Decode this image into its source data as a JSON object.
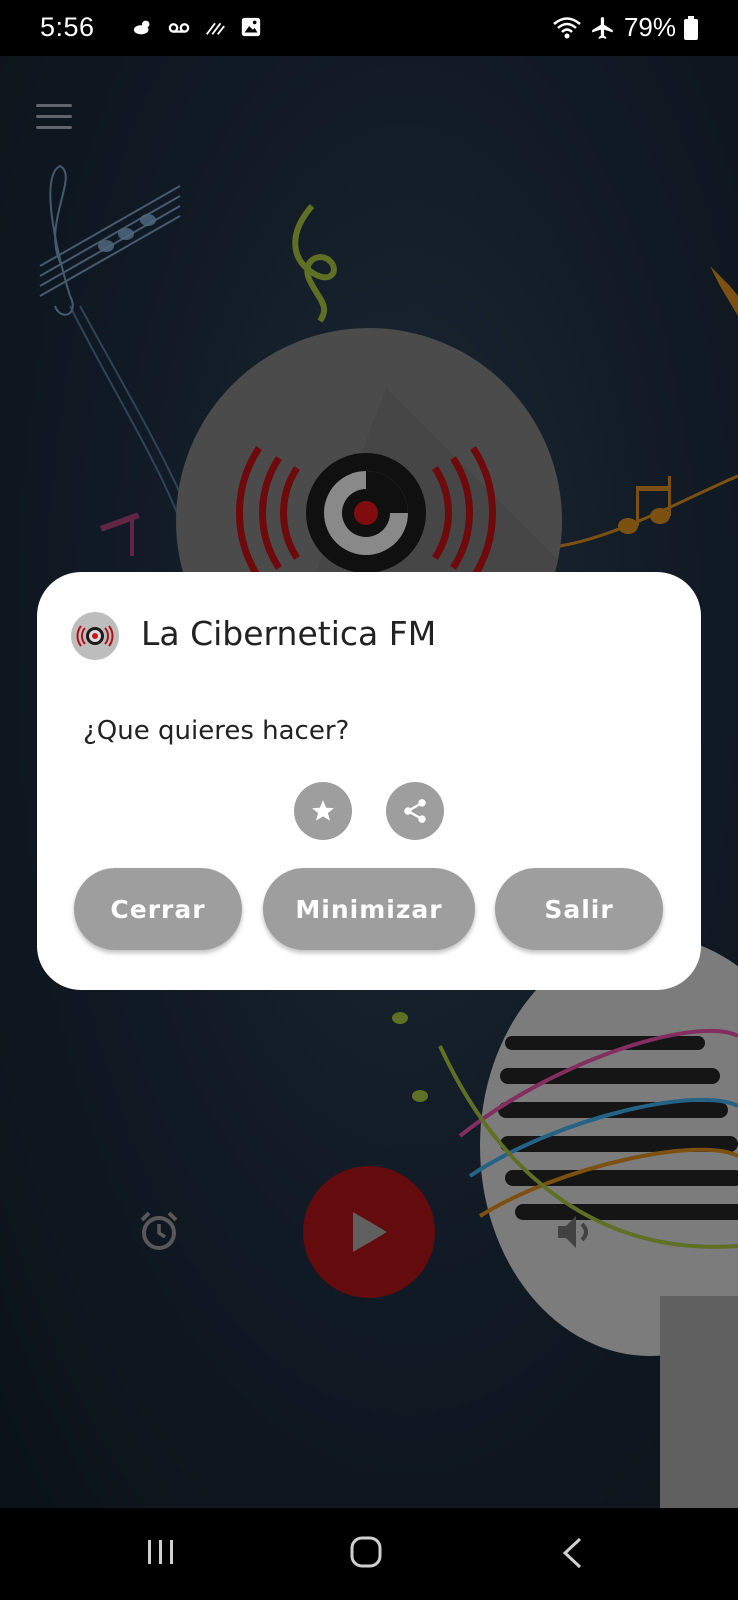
{
  "status_bar": {
    "time": "5:56",
    "battery": "79%",
    "icons_left": [
      "weather-icon",
      "voicemail-icon",
      "data-icon",
      "gallery-icon"
    ],
    "icons_right": [
      "wifi-icon",
      "airplane-icon",
      "battery-icon"
    ]
  },
  "app": {
    "menu_icon": "hamburger-menu-icon",
    "accent_color": "#a01216"
  },
  "dialog": {
    "title": "La Cibernetica FM",
    "question": "¿Que quieres hacer?",
    "icon_actions": [
      "star-icon",
      "share-icon"
    ],
    "buttons": {
      "close": "Cerrar",
      "minimize": "Minimizar",
      "exit": "Salir"
    },
    "button_color": "#9e9e9e"
  },
  "player": {
    "alarm_icon": "alarm-clock-icon",
    "play_icon": "play-icon",
    "volume_icon": "volume-icon"
  },
  "nav_bar": {
    "items": [
      "recent-apps-icon",
      "home-icon",
      "back-icon"
    ]
  }
}
